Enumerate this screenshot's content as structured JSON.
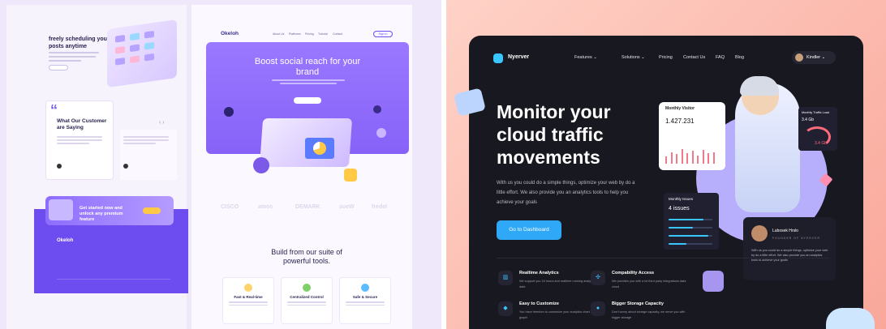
{
  "left": {
    "scheduling": {
      "title": "freely scheduling your posts anytime"
    },
    "testimonials": {
      "quote_mark": "“",
      "title": "What Our Customer are Saying",
      "arrows": "‹ ›"
    },
    "banner": {
      "text": "Get started now and unlock any premium feature"
    },
    "footer": {
      "logo": "Okeloh"
    },
    "nav": {
      "logo": "Okeloh",
      "items": [
        "About Us",
        "Platforms",
        "Pricing",
        "Tutorial",
        "Contact"
      ],
      "signin": "Sign In"
    },
    "hero": {
      "title": "Boost social reach for your brand"
    },
    "brands": [
      "CISCO",
      "amos",
      "DEMARK",
      "sueW",
      "fredel"
    ],
    "build": {
      "title": "Build from our suite of powerful tools."
    },
    "features": [
      {
        "title": "Fast & Real-time",
        "color": "#ffd36b"
      },
      {
        "title": "Centralized Control",
        "color": "#7fd06b"
      },
      {
        "title": "Safe & Secure",
        "color": "#5bbcff"
      }
    ]
  },
  "right": {
    "brand": {
      "name": "Nyerver"
    },
    "nav": {
      "items": [
        "Features ⌄",
        "Solutions ⌄",
        "Pricing",
        "Contact Us",
        "FAQ",
        "Blog"
      ],
      "user": "Kindler ⌄"
    },
    "hero": {
      "title": "Monitor your cloud traffic movements",
      "subtitle": "With us you could do a simple things, optimize your web by do a little effort. We also provide you an analytics tools to help you achieve your goals",
      "cta": "Go to Dashboard"
    },
    "visitor_card": {
      "title": "Monthly Visitor",
      "value": "1.427.231",
      "bars": [
        0.35,
        0.55,
        0.45,
        0.7,
        0.5,
        0.6,
        0.4,
        0.65,
        0.5,
        0.55
      ]
    },
    "traffic_card": {
      "title": "Monthly Traffic Load",
      "value": "3.4 Gb",
      "value2": "3.4 Gb"
    },
    "issues_card": {
      "title": "Monthly Issues",
      "value": "4 issues",
      "levels": [
        0.8,
        0.55,
        0.9,
        0.4
      ]
    },
    "review": {
      "name": "Lubosek Hrslo",
      "role": "FOUNDER OF NYERVER",
      "text": "With us you could do a simple things, optimize your web by do a little effort. We also provide you an analytics tools to achieve your goals"
    },
    "features": [
      {
        "title": "Realtime Analytics",
        "desc": "We support you 24 hours and realtime running analytics data",
        "icon": "chart-icon"
      },
      {
        "title": "Compability Access",
        "desc": "We provides you with a lot third party integrations data cloud",
        "icon": "plug-icon"
      },
      {
        "title": "Easy to Customize",
        "desc": "You have freedom to customize your analytics chart and graph",
        "icon": "brush-icon"
      },
      {
        "title": "Bigger Storage Capacity",
        "desc": "Don't worry about storage capacity, we serve you with bigger storage",
        "icon": "storage-icon"
      }
    ]
  }
}
